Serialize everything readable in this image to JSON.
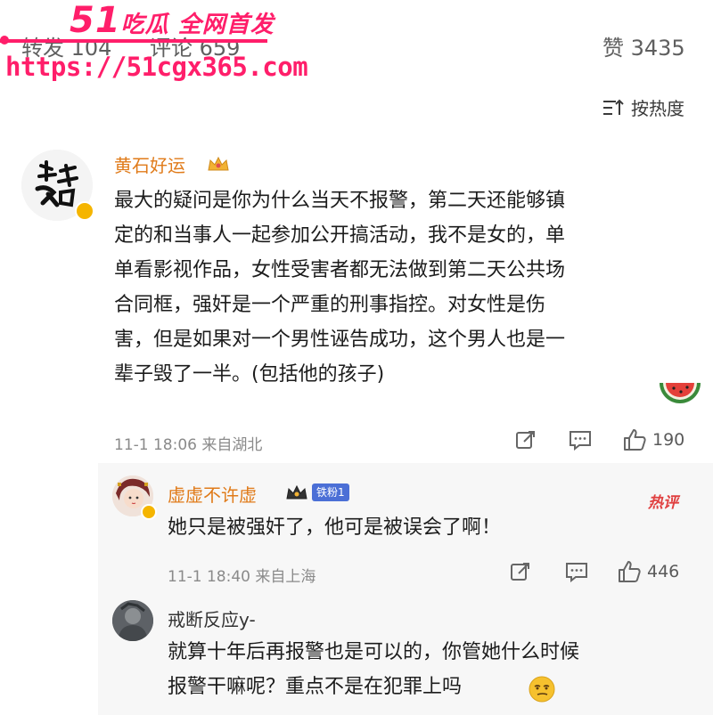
{
  "watermark": {
    "brand_number": "51",
    "brand_text": "吃瓜 全网首发",
    "url": "https://51cgx365.com"
  },
  "stats": {
    "repost": "转发 104",
    "comment": "评论 659",
    "like": "赞 3435"
  },
  "sort": {
    "label": "按热度"
  },
  "comment": {
    "username": "黄石好运",
    "text": "最大的疑问是你为什么当天不报警，第二天还能够镇\n定的和当事人一起参加公开搞活动，我不是女的，单\n单看影视作品，女性受害者都无法做到第二天公共场\n合同框，强奸是一个严重的刑事指控。对女性是伤\n害，但是如果对一个男性诬告成功，这个男人也是一\n辈子毁了一半。(包括他的孩子)",
    "time": "11-1 18:06 来自湖北",
    "likes": "190"
  },
  "replies": [
    {
      "username": "虚虚不许虚",
      "badge": "铁粉1",
      "hot": "热评",
      "text": "她只是被强奸了，他可是被误会了啊！",
      "time": "11-1 18:40 来自上海",
      "likes": "446"
    },
    {
      "username": "戒断反应y-",
      "text": "就算十年后再报警也是可以的，你管她什么时候\n报警干嘛呢？重点不是在犯罪上吗"
    }
  ],
  "colors": {
    "username": "#e07b1a",
    "watermark": "#ff1e6a",
    "fan_badge": "#4b6fd6",
    "hot": "#e04040"
  }
}
